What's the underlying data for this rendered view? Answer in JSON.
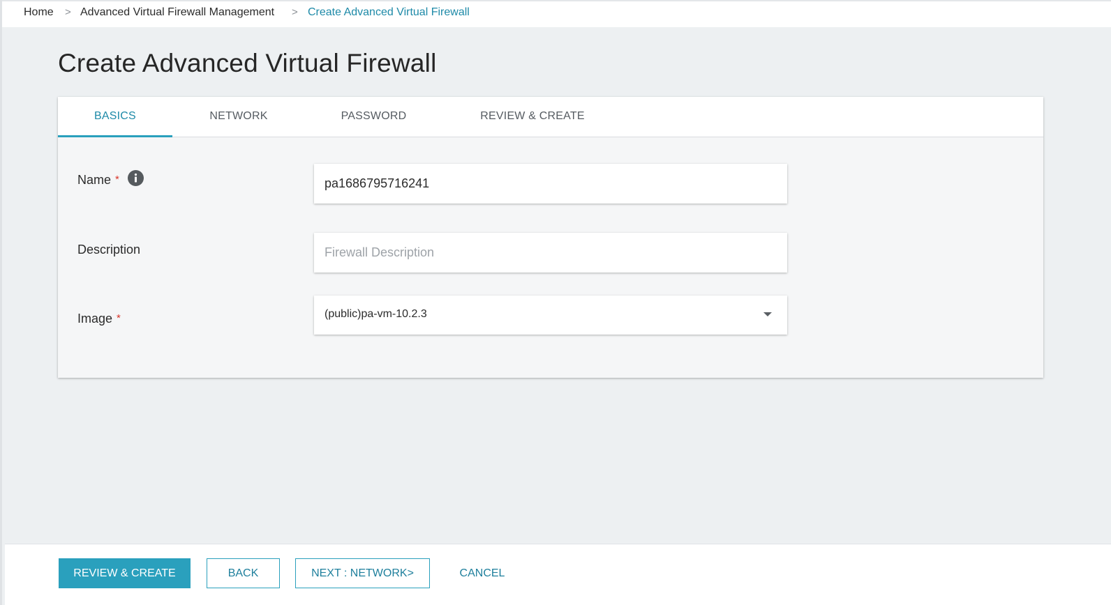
{
  "breadcrumb": {
    "items": [
      "Home",
      "Advanced Virtual Firewall Management",
      "Create Advanced Virtual Firewall"
    ],
    "separator": ">"
  },
  "page": {
    "title": "Create Advanced Virtual Firewall"
  },
  "tabs": [
    "BASICS",
    "NETWORK",
    "PASSWORD",
    "REVIEW & CREATE"
  ],
  "active_tab": "BASICS",
  "form": {
    "name": {
      "label": "Name",
      "required_mark": "*",
      "value": "pa1686795716241",
      "icon": "info-icon"
    },
    "description": {
      "label": "Description",
      "value": "",
      "placeholder": "Firewall Description"
    },
    "image": {
      "label": "Image",
      "required_mark": "*",
      "selected": "(public)pa-vm-10.2.3",
      "icon": "caret-down-icon"
    }
  },
  "footer": {
    "review_create": "REVIEW & CREATE",
    "back": "BACK",
    "next": "NEXT : NETWORK>",
    "cancel": "CANCEL"
  },
  "colors": {
    "accent": "#2aa0bd",
    "link": "#1e8aa8",
    "required": "#d9362b",
    "background": "#edf0f2"
  }
}
